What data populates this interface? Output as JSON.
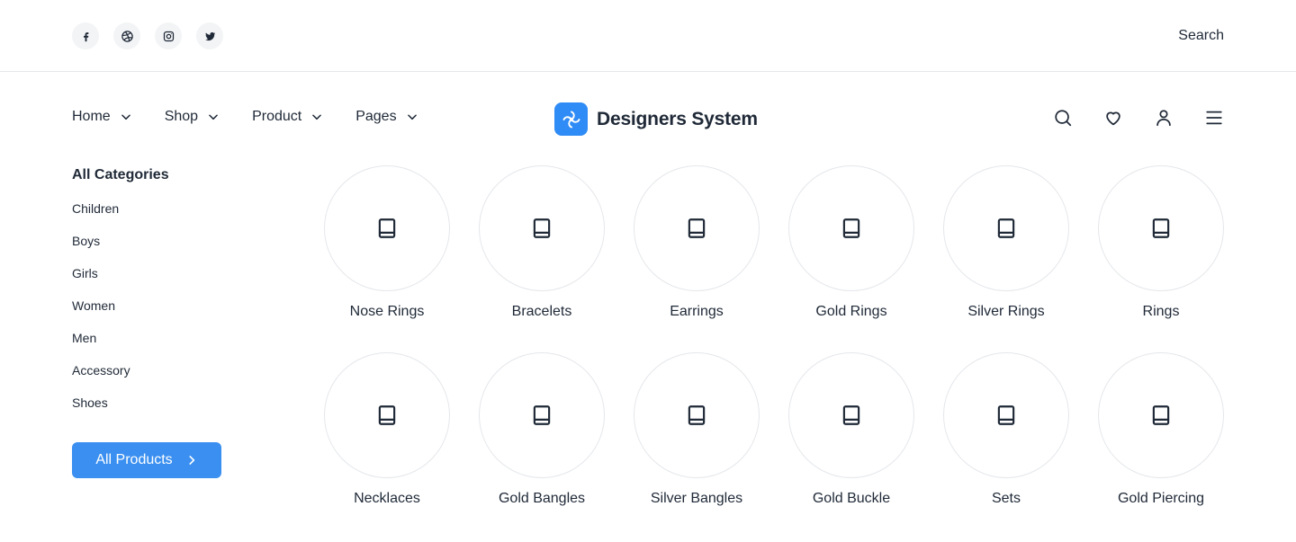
{
  "socials": [
    {
      "icon": "facebook-icon"
    },
    {
      "icon": "dribbble-icon"
    },
    {
      "icon": "instagram-icon"
    },
    {
      "icon": "twitter-icon"
    }
  ],
  "topbar": {
    "search_label": "Search"
  },
  "nav": {
    "items": [
      {
        "label": "Home"
      },
      {
        "label": "Shop"
      },
      {
        "label": "Product"
      },
      {
        "label": "Pages"
      }
    ]
  },
  "brand": {
    "name": "Designers System",
    "color": "#2f8bf5"
  },
  "sidebar": {
    "title": "All Categories",
    "categories": [
      "Children",
      "Boys",
      "Girls",
      "Women",
      "Men",
      "Accessory",
      "Shoes"
    ],
    "button_label": "All Products",
    "button_color": "#3a8ff0"
  },
  "grid": {
    "tiles": [
      {
        "label": "Nose Rings",
        "icon": "book-icon"
      },
      {
        "label": "Bracelets",
        "icon": "book-icon"
      },
      {
        "label": "Earrings",
        "icon": "book-icon"
      },
      {
        "label": "Gold Rings",
        "icon": "book-icon"
      },
      {
        "label": "Silver Rings",
        "icon": "book-icon"
      },
      {
        "label": "Rings",
        "icon": "book-icon"
      },
      {
        "label": "Necklaces",
        "icon": "book-icon"
      },
      {
        "label": "Gold Bangles",
        "icon": "book-icon"
      },
      {
        "label": "Silver Bangles",
        "icon": "book-icon"
      },
      {
        "label": "Gold Buckle",
        "icon": "book-icon"
      },
      {
        "label": "Sets",
        "icon": "book-icon"
      },
      {
        "label": "Gold Piercing",
        "icon": "book-icon"
      }
    ]
  }
}
